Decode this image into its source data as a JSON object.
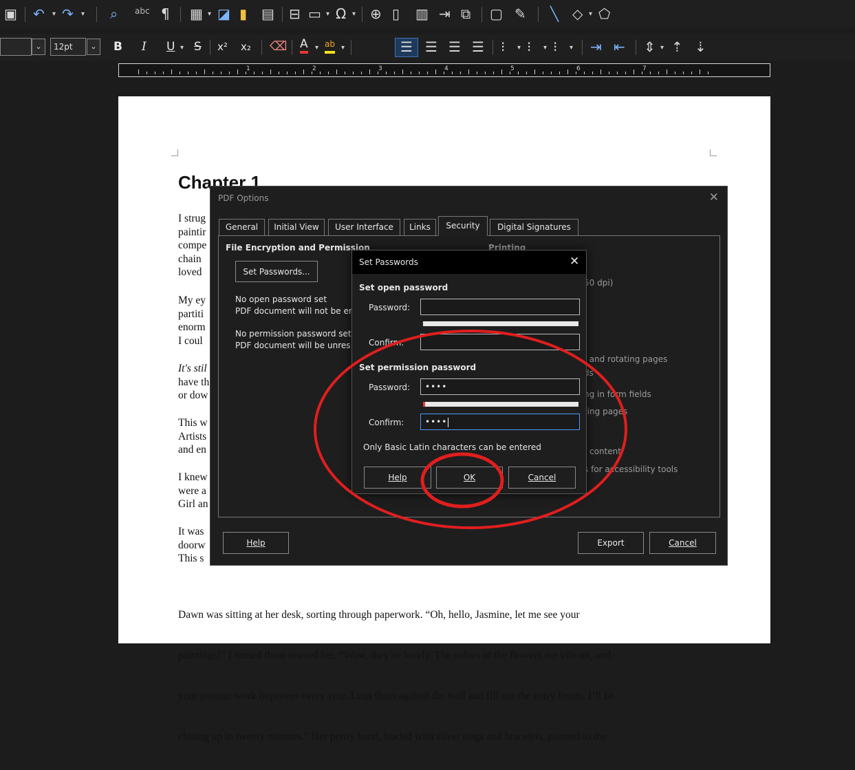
{
  "toolbar": {
    "font_size": "12pt",
    "spellcheck_label": "abc",
    "format_bold": "B",
    "format_italic": "I",
    "format_underline": "U",
    "format_strike": "S",
    "superscript": "x²",
    "subscript": "x₂",
    "font_color_label": "A",
    "highlight_label": "ab"
  },
  "ruler": {
    "numbers": [
      "1",
      "2",
      "3",
      "4",
      "5",
      "6",
      "7"
    ]
  },
  "document": {
    "heading": "Chapter 1",
    "visible_line_starts": [
      [
        "I strug",
        "paintir",
        "compe",
        "chain",
        "loved"
      ],
      [
        "My ey",
        "partiti",
        "enorm",
        "I coul"
      ],
      [
        "It's stil",
        "have th",
        "or dow"
      ],
      [
        "This w",
        "Artists",
        "and en"
      ],
      [
        "I knew",
        "were a",
        "Girl an"
      ],
      [
        "It was",
        "doorw",
        "This s"
      ]
    ],
    "bottom_paragraph": [
      "Dawn was sitting at her desk, sorting through paperwork. “Oh, hello, Jasmine, let me see your",
      "paintings!” I turned them toward her. “Wow, they’re lovely. The colors of the flowers are vibrant, and",
      "your portrait work improves every year. Lean them against the wall and fill out the entry forms. I’ll be",
      "closing up in twenty minutes.” Her pretty hand, loaded with silver rings and bracelets, pointed to the"
    ]
  },
  "pdf_dialog": {
    "title": "PDF Options",
    "tabs": [
      "General",
      "Initial View",
      "User Interface",
      "Links",
      "Security",
      "Digital Signatures"
    ],
    "active_tab": "Security",
    "section_heading": "File Encryption and Permission",
    "set_passwords_button": "Set Passwords...",
    "open_pw_status_1": "No open password set",
    "open_pw_status_2": "PDF document will not be er",
    "perm_pw_status_1": "No permission password set",
    "perm_pw_status_2": "PDF document will be unres",
    "printing_heading": "Printing",
    "background_texts": [
      "50 dpi)",
      ", and rotating pages",
      "ds",
      "ng in form fields",
      "ting pages",
      "f content",
      "s for accessibility tools"
    ],
    "help_button": "Help",
    "export_button": "Export",
    "cancel_button": "Cancel"
  },
  "set_passwords_dialog": {
    "title": "Set Passwords",
    "open_heading": "Set open password",
    "password_label": "Password:",
    "confirm_label": "Confirm:",
    "open_password_value": "",
    "open_confirm_value": "",
    "permission_heading": "Set permission password",
    "permission_password_value": "••••",
    "permission_confirm_value": "••••",
    "open_strength": 0,
    "permission_strength": 0.015,
    "note": "Only Basic Latin characters can be entered",
    "help_button": "Help",
    "ok_button": "OK",
    "cancel_button": "Cancel"
  },
  "colors": {
    "annotation": "#e01e1e",
    "focus": "#4c9aff",
    "strength_fill": "#e53935"
  }
}
